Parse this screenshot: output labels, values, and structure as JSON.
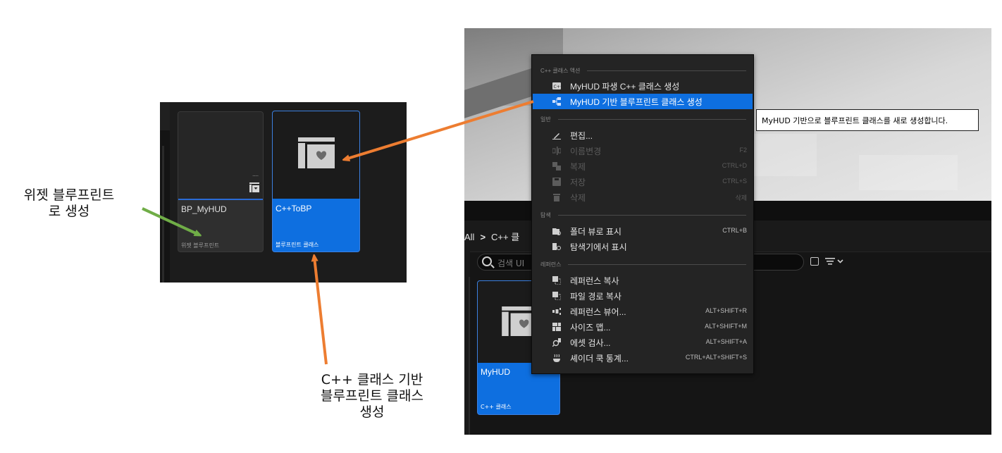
{
  "left_panel": {
    "cards": [
      {
        "name": "BP_MyHUD",
        "type": "위젯 블루프린트",
        "dots": "...."
      },
      {
        "name": "C++ToBP",
        "type": "블루프린트 클래스"
      }
    ]
  },
  "editor": {
    "breadcrumb": {
      "root": "All",
      "sep": ">",
      "current": "C++ 클"
    },
    "search_placeholder": "검색 UI",
    "asset": {
      "name": "MyHUD",
      "type": "C++ 클래스"
    }
  },
  "context_menu": {
    "sections": [
      {
        "title": "C++ 클래스 액션",
        "items": [
          {
            "label": "MyHUD 파생 C++ 클래스 생성",
            "shortcut": "",
            "icon": "cpp-class-icon",
            "enabled": true
          },
          {
            "label": "MyHUD 기반 블루프린트 클래스 생성",
            "shortcut": "",
            "icon": "blueprint-class-icon",
            "enabled": true,
            "highlighted": true
          }
        ]
      },
      {
        "title": "일반",
        "items": [
          {
            "label": "편집...",
            "shortcut": "",
            "icon": "edit-icon",
            "enabled": true
          },
          {
            "label": "이름변경",
            "shortcut": "F2",
            "icon": "rename-icon",
            "enabled": false
          },
          {
            "label": "복제",
            "shortcut": "CTRL+D",
            "icon": "duplicate-icon",
            "enabled": false
          },
          {
            "label": "저장",
            "shortcut": "CTRL+S",
            "icon": "save-icon",
            "enabled": false
          },
          {
            "label": "삭제",
            "shortcut": "삭제",
            "icon": "delete-icon",
            "enabled": false
          }
        ]
      },
      {
        "title": "탐색",
        "items": [
          {
            "label": "폴더 뷰로 표시",
            "shortcut": "CTRL+B",
            "icon": "folder-view-icon",
            "enabled": true
          },
          {
            "label": "탐색기에서 표시",
            "shortcut": "",
            "icon": "explorer-icon",
            "enabled": true
          }
        ]
      },
      {
        "title": "레퍼런스",
        "items": [
          {
            "label": "레퍼런스 복사",
            "shortcut": "",
            "icon": "copy-reference-icon",
            "enabled": true
          },
          {
            "label": "파일 경로 복사",
            "shortcut": "",
            "icon": "copy-path-icon",
            "enabled": true
          },
          {
            "label": "레퍼런스 뷰어...",
            "shortcut": "ALT+SHIFT+R",
            "icon": "reference-viewer-icon",
            "enabled": true
          },
          {
            "label": "사이즈 맵...",
            "shortcut": "ALT+SHIFT+M",
            "icon": "size-map-icon",
            "enabled": true
          },
          {
            "label": "에셋 검사...",
            "shortcut": "ALT+SHIFT+A",
            "icon": "audit-icon",
            "enabled": true
          },
          {
            "label": "셰이더 쿡 통계...",
            "shortcut": "CTRL+ALT+SHIFT+S",
            "icon": "shader-stats-icon",
            "enabled": true
          }
        ]
      }
    ]
  },
  "tooltip": "MyHUD 기반으로 블루프린트 클래스를 새로 생성합니다.",
  "annotations": {
    "widget_line1": "위젯 블루프린트",
    "widget_line2": "로 생성",
    "cpp_line1": "C++ 클래스 기반",
    "cpp_line2": "블루프린트 클래스",
    "cpp_line3": "생성"
  },
  "colors": {
    "selection_blue": "#0e6fe0",
    "arrow_orange": "#ed7d31",
    "arrow_green": "#70ad47"
  }
}
